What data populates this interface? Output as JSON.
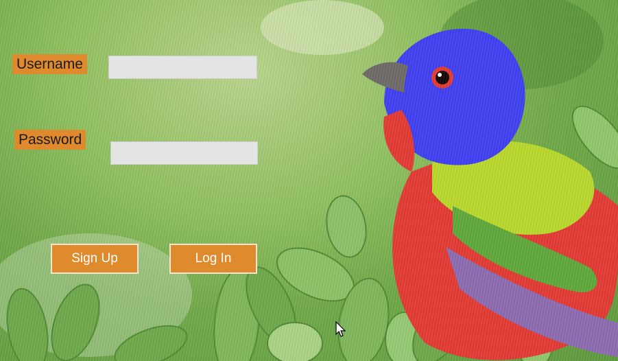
{
  "login_form": {
    "username_label": "Username",
    "password_label": "Password",
    "username_value": "",
    "password_value": "",
    "signup_label": "Sign Up",
    "login_label": "Log In"
  },
  "background": {
    "subject": "painted-bunting-bird-on-foliage"
  },
  "colors": {
    "accent": "#e08a2e",
    "field": "#e4e4e4",
    "button_border": "#f6e6d0"
  }
}
